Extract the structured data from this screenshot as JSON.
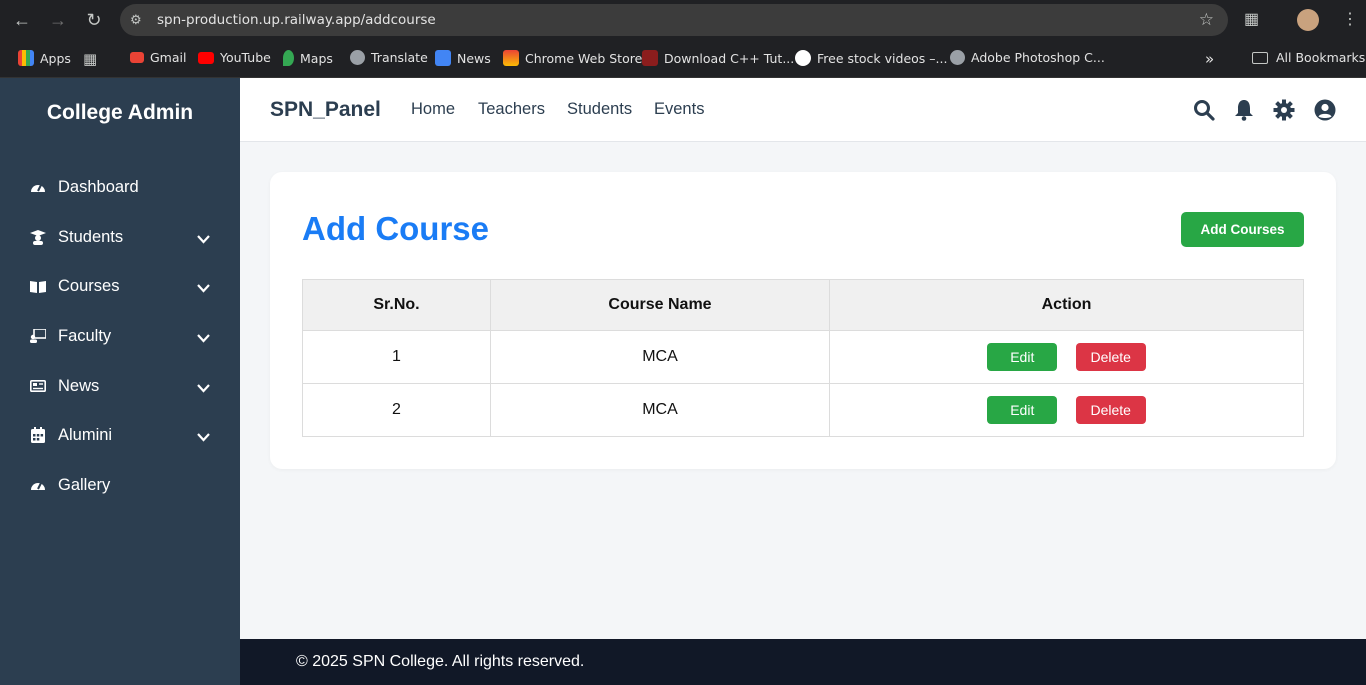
{
  "browser": {
    "url": "spn-production.up.railway.app/addcourse",
    "bookmarks": [
      "Apps",
      "Gmail",
      "YouTube",
      "Maps",
      "Translate",
      "News",
      "Chrome Web Store",
      "Download C++ Tut...",
      "Free stock videos –...",
      "Adobe Photoshop C..."
    ],
    "all_bookmarks": "All Bookmarks",
    "overflow": "»"
  },
  "sidebar": {
    "brand": "College Admin",
    "items": [
      {
        "label": "Dashboard",
        "icon": "gauge-icon",
        "expandable": false
      },
      {
        "label": "Students",
        "icon": "graduate-icon",
        "expandable": true
      },
      {
        "label": "Courses",
        "icon": "book-icon",
        "expandable": true
      },
      {
        "label": "Faculty",
        "icon": "teacher-icon",
        "expandable": true
      },
      {
        "label": "News",
        "icon": "newspaper-icon",
        "expandable": true
      },
      {
        "label": "Alumini",
        "icon": "calendar-icon",
        "expandable": true
      },
      {
        "label": "Gallery",
        "icon": "gauge-icon",
        "expandable": false
      }
    ]
  },
  "topnav": {
    "logo": "SPN_Panel",
    "links": [
      "Home",
      "Teachers",
      "Students",
      "Events"
    ],
    "icons": [
      "search-icon",
      "bell-icon",
      "gear-icon",
      "user-circle-icon"
    ]
  },
  "main": {
    "title": "Add Course",
    "add_button": "Add Courses",
    "table": {
      "headers": [
        "Sr.No.",
        "Course Name",
        "Action"
      ],
      "rows": [
        {
          "sr": "1",
          "name": "MCA"
        },
        {
          "sr": "2",
          "name": "MCA"
        }
      ],
      "edit_label": "Edit",
      "delete_label": "Delete"
    }
  },
  "footer": {
    "text": "© 2025 SPN College. All rights reserved."
  },
  "colors": {
    "sidebar": "#2c3e50",
    "accent": "#1a7cf5",
    "success": "#28a745",
    "danger": "#dc3545",
    "footer": "#111827"
  }
}
